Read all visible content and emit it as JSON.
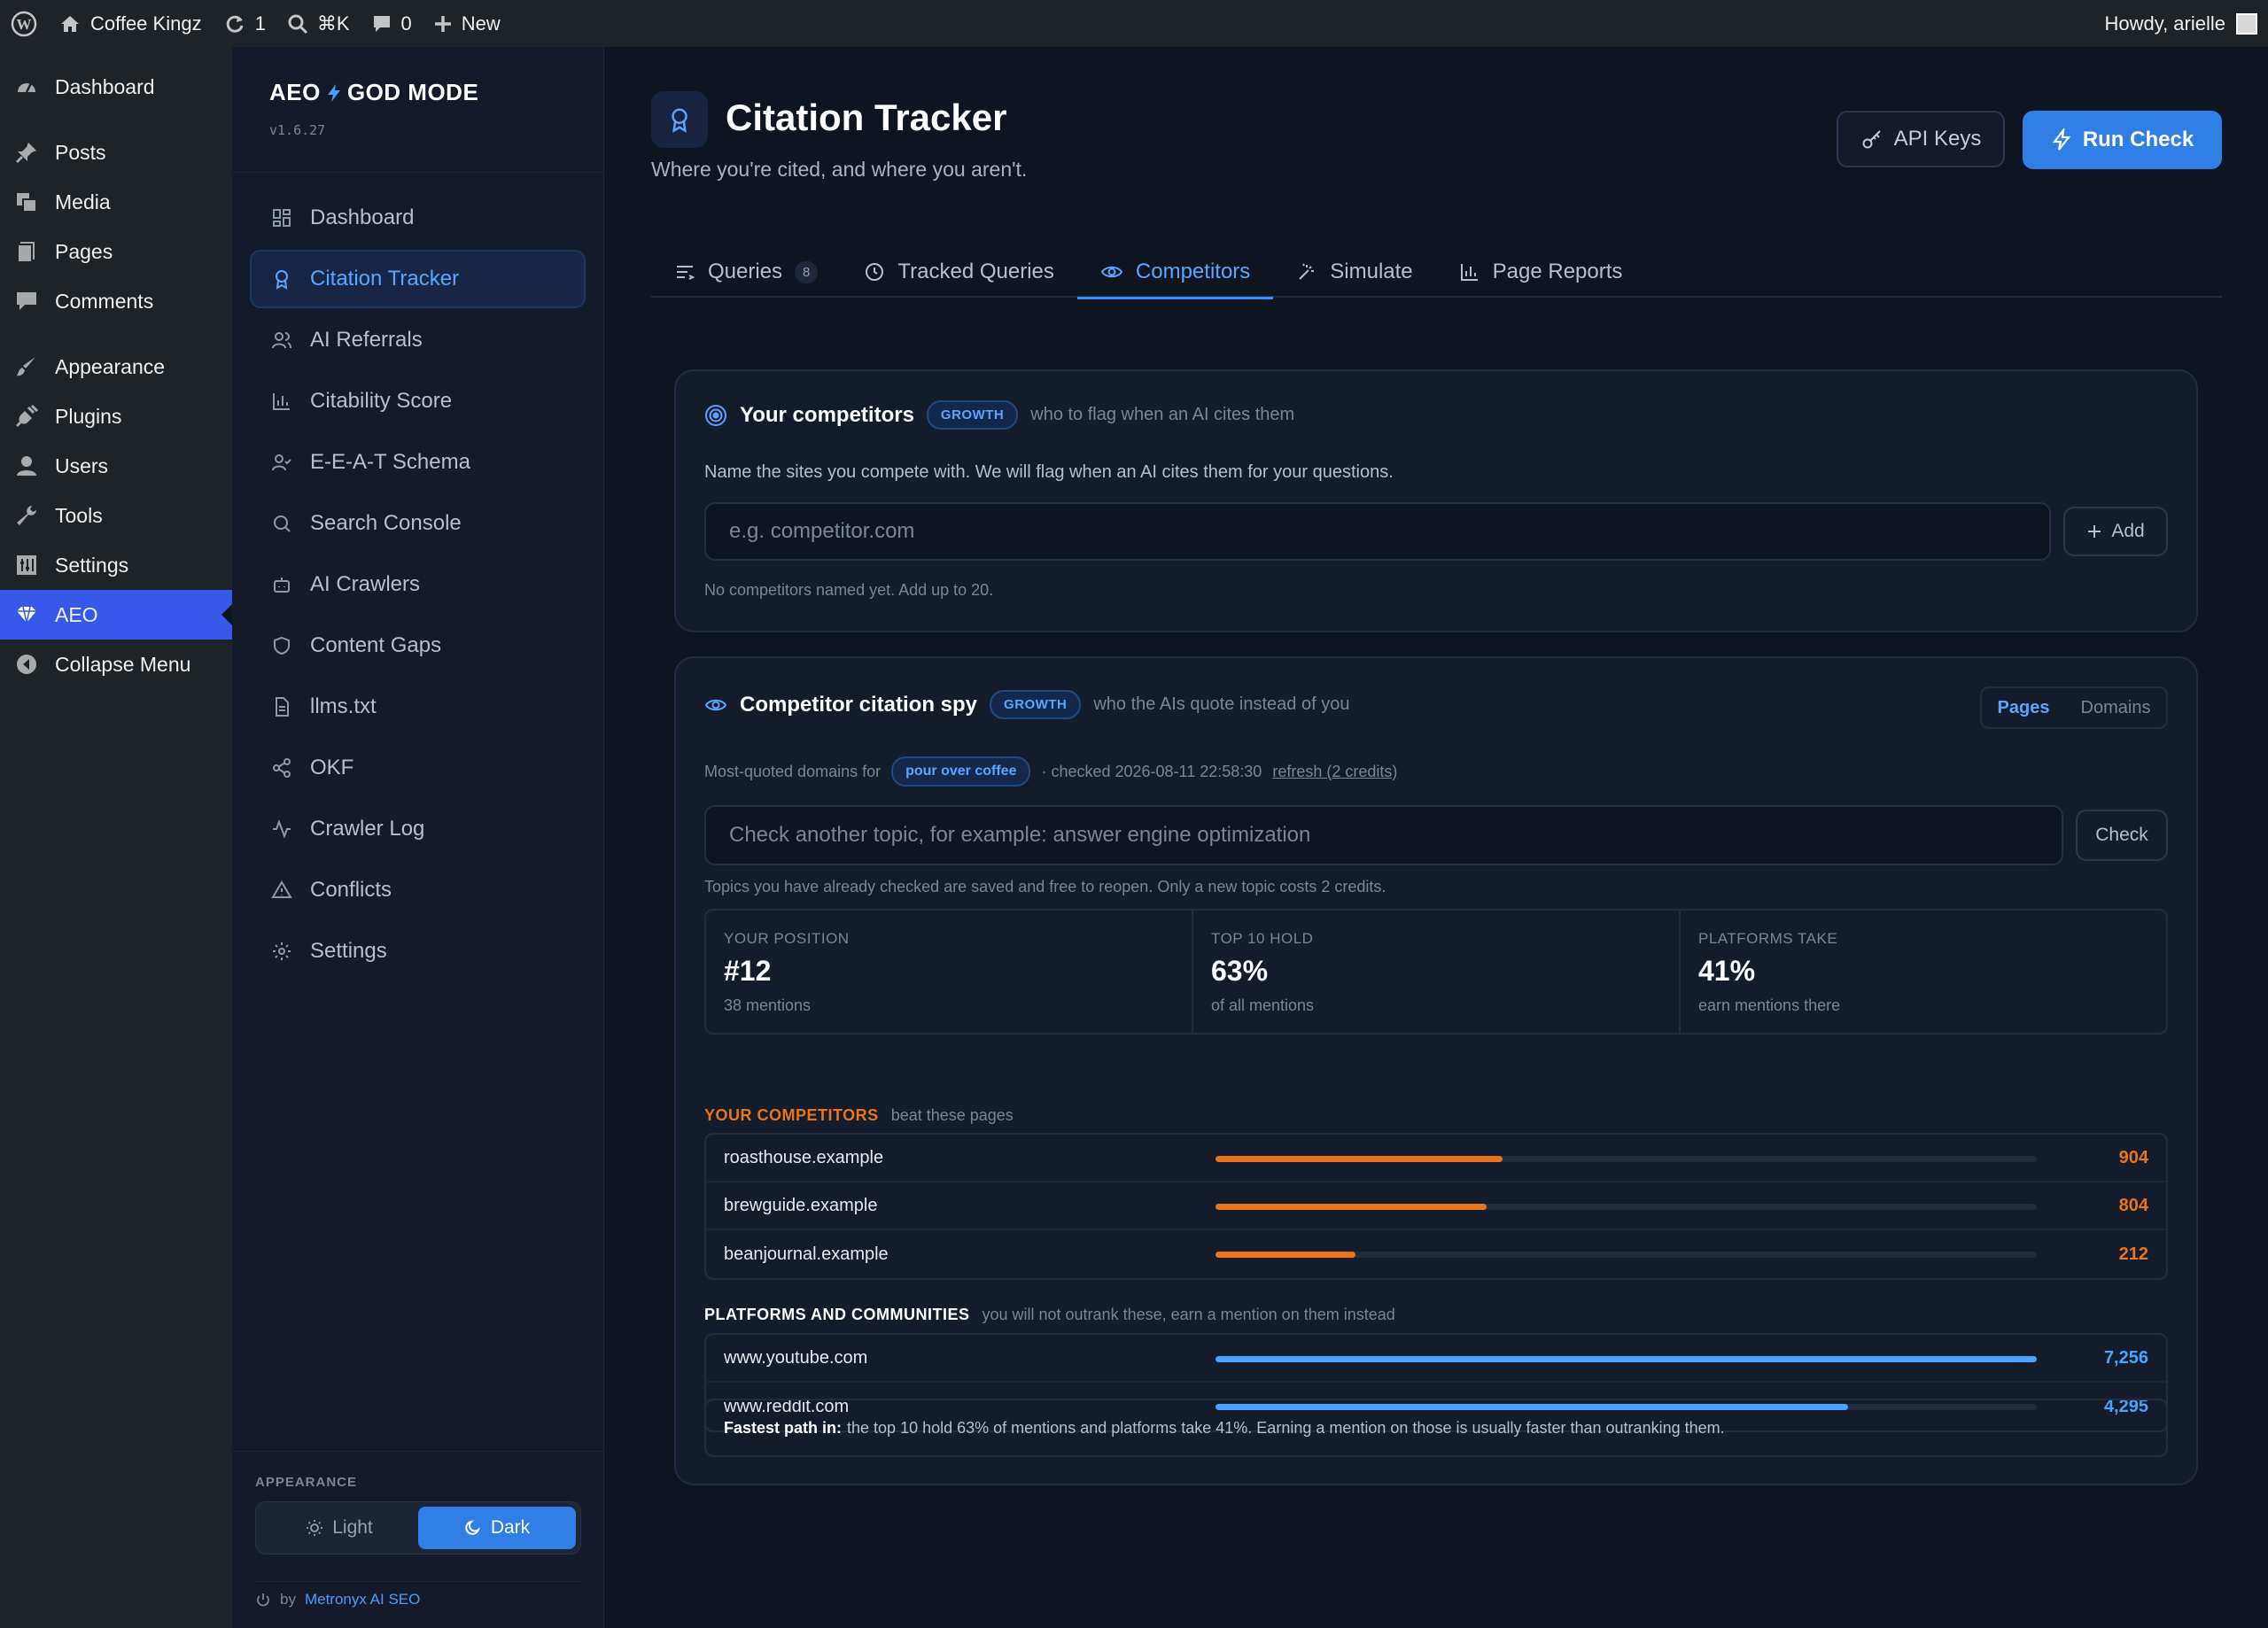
{
  "adminbar": {
    "site_name": "Coffee Kingz",
    "updates_count": "1",
    "search_shortcut": "⌘K",
    "comments_count": "0",
    "new_label": "New",
    "howdy": "Howdy, arielle"
  },
  "wp_menu": {
    "items": [
      {
        "label": "Dashboard",
        "icon": "dashboard-icon"
      },
      {
        "label": "Posts",
        "icon": "pin-icon"
      },
      {
        "label": "Media",
        "icon": "media-icon"
      },
      {
        "label": "Pages",
        "icon": "pages-icon"
      },
      {
        "label": "Comments",
        "icon": "comment-icon"
      },
      {
        "label": "Appearance",
        "icon": "brush-icon"
      },
      {
        "label": "Plugins",
        "icon": "plug-icon"
      },
      {
        "label": "Users",
        "icon": "user-icon"
      },
      {
        "label": "Tools",
        "icon": "wrench-icon"
      },
      {
        "label": "Settings",
        "icon": "settings-icon"
      },
      {
        "label": "AEO",
        "icon": "aeo-icon"
      },
      {
        "label": "Collapse Menu",
        "icon": "collapse-icon"
      }
    ]
  },
  "plugin": {
    "brand_left": "AEO",
    "brand_right": "GOD MODE",
    "version": "v1.6.27",
    "nav": [
      {
        "label": "Dashboard"
      },
      {
        "label": "Citation Tracker"
      },
      {
        "label": "AI Referrals"
      },
      {
        "label": "Citability Score"
      },
      {
        "label": "E-E-A-T Schema"
      },
      {
        "label": "Search Console"
      },
      {
        "label": "AI Crawlers"
      },
      {
        "label": "Content Gaps"
      },
      {
        "label": "llms.txt"
      },
      {
        "label": "OKF"
      },
      {
        "label": "Crawler Log"
      },
      {
        "label": "Conflicts"
      },
      {
        "label": "Settings"
      }
    ],
    "appearance_label": "APPEARANCE",
    "theme_light": "Light",
    "theme_dark": "Dark",
    "credit_by": "by",
    "credit_link": "Metronyx AI SEO"
  },
  "header": {
    "title": "Citation Tracker",
    "subtitle": "Where you're cited, and where you aren't.",
    "api_keys": "API Keys",
    "run_check": "Run Check"
  },
  "tabs": [
    {
      "label": "Queries",
      "badge": "8"
    },
    {
      "label": "Tracked Queries"
    },
    {
      "label": "Competitors"
    },
    {
      "label": "Simulate"
    },
    {
      "label": "Page Reports"
    }
  ],
  "competitors_card": {
    "title": "Your competitors",
    "pill": "GROWTH",
    "hint": "who to flag when an AI cites them",
    "desc": "Name the sites you compete with. We will flag when an AI cites them for your questions.",
    "placeholder": "e.g. competitor.com",
    "add": "Add",
    "footnote": "No competitors named yet. Add up to 20."
  },
  "spy_card": {
    "title": "Competitor citation spy",
    "pill": "GROWTH",
    "hint": "who the AIs quote instead of you",
    "seg_pages": "Pages",
    "seg_domains": "Domains",
    "most_quoted": "Most-quoted domains for",
    "topic": "pour over coffee",
    "checked": "· checked 2026-08-11 22:58:30",
    "refresh": "refresh (2 credits)",
    "placeholder": "Check another topic, for example: answer engine optimization",
    "check": "Check",
    "topics_note": "Topics you have already checked are saved and free to reopen. Only a new topic costs 2 credits.",
    "stats": [
      {
        "label": "YOUR POSITION",
        "value": "#12",
        "sub": "38 mentions"
      },
      {
        "label": "TOP 10 HOLD",
        "value": "63%",
        "sub": "of all mentions"
      },
      {
        "label": "PLATFORMS TAKE",
        "value": "41%",
        "sub": "earn mentions there"
      }
    ],
    "competitors_label": "YOUR COMPETITORS",
    "competitors_sub": "beat these pages",
    "competitors": [
      {
        "domain": "roasthouse.example",
        "value": "904",
        "fill": 0.35
      },
      {
        "domain": "brewguide.example",
        "value": "804",
        "fill": 0.33
      },
      {
        "domain": "beanjournal.example",
        "value": "212",
        "fill": 0.17
      }
    ],
    "platforms_label": "PLATFORMS AND COMMUNITIES",
    "platforms_sub": "you will not outrank these, earn a mention on them instead",
    "platforms": [
      {
        "domain": "www.youtube.com",
        "value": "7,256",
        "fill": 1.0
      },
      {
        "domain": "www.reddit.com",
        "value": "4,295",
        "fill": 0.77
      }
    ],
    "fastest_bold": "Fastest path in:",
    "fastest_text": "the top 10 hold 63% of mentions and platforms take 41%. Earning a mention on those is usually faster than outranking them."
  },
  "colors": {
    "accent": "#2f7fe6",
    "competitor_bar": "#e8741c",
    "platform_bar": "#4aa3ff"
  }
}
